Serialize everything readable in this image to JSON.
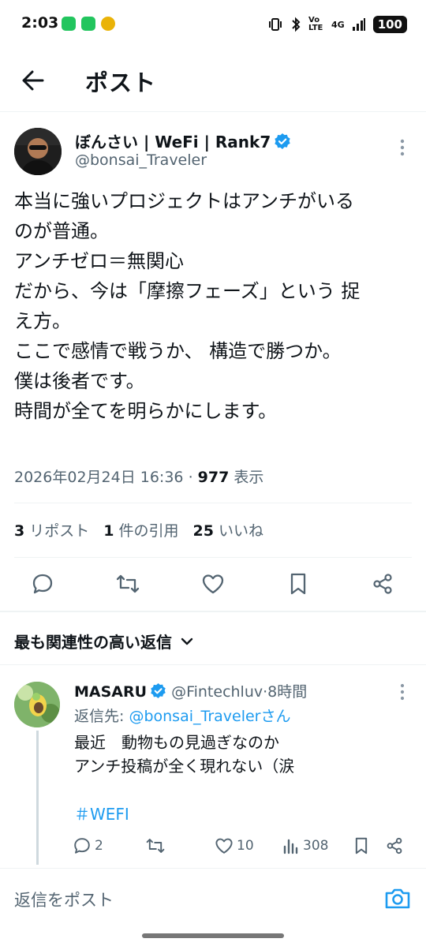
{
  "status_bar": {
    "time": "2:03",
    "network": "4G",
    "volte": "Vo LTE",
    "battery": "100"
  },
  "header": {
    "title": "ポスト"
  },
  "post": {
    "author_name": "ぼんさい | WeFi | Rank7",
    "author_handle": "@bonsai_Traveler",
    "text": "本当に強いプロジェクトはアンチがいる\nのが普通。\nアンチゼロ＝無関心\nだから、今は「摩擦フェーズ」という 捉\nえ方。\nここで感情で戦うか、 構造で勝つか。\n僕は後者です。\n時間が全てを明らかにします。",
    "timestamp": "2026年02月24日 16:36",
    "views": "977",
    "views_label": "表示",
    "reposts": "3",
    "reposts_label": "リポスト",
    "quotes": "1",
    "quotes_label": "件の引用",
    "likes": "25",
    "likes_label": "いいね"
  },
  "replies_sort": {
    "label": "最も関連性の高い返信"
  },
  "reply": {
    "name": "MASARU",
    "handle": "@Fintechluv",
    "dot": "·",
    "time": "8時間",
    "reply_to_prefix": "返信先: ",
    "reply_to_handle": "@bonsai_Travelerさん",
    "text": "最近　動物もの見過ぎなのか\nアンチ投稿が全く現れない（涙",
    "hashtag": "＃WEFI",
    "replies": "2",
    "likes": "10",
    "views": "308"
  },
  "composer": {
    "placeholder": "返信をポスト"
  },
  "colors": {
    "accent": "#1d9bf0",
    "text": "#0f1419",
    "secondary": "#536471",
    "border": "#eff3f4"
  }
}
